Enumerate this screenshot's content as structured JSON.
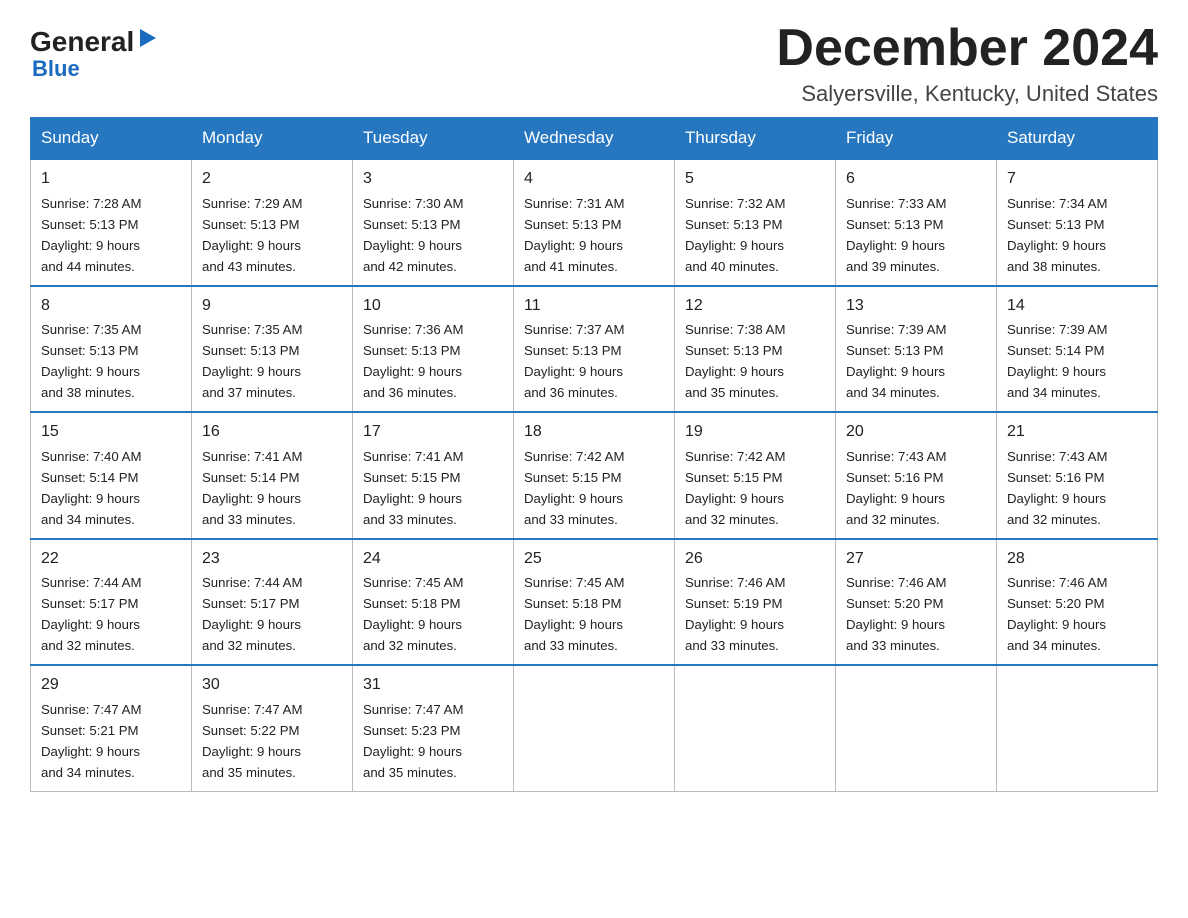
{
  "header": {
    "logo_main": "General",
    "logo_arrow": "▶",
    "logo_sub": "Blue",
    "month_title": "December 2024",
    "location": "Salyersville, Kentucky, United States"
  },
  "weekdays": [
    "Sunday",
    "Monday",
    "Tuesday",
    "Wednesday",
    "Thursday",
    "Friday",
    "Saturday"
  ],
  "weeks": [
    [
      {
        "day": "1",
        "sunrise": "Sunrise: 7:28 AM",
        "sunset": "Sunset: 5:13 PM",
        "daylight": "Daylight: 9 hours",
        "daylight2": "and 44 minutes."
      },
      {
        "day": "2",
        "sunrise": "Sunrise: 7:29 AM",
        "sunset": "Sunset: 5:13 PM",
        "daylight": "Daylight: 9 hours",
        "daylight2": "and 43 minutes."
      },
      {
        "day": "3",
        "sunrise": "Sunrise: 7:30 AM",
        "sunset": "Sunset: 5:13 PM",
        "daylight": "Daylight: 9 hours",
        "daylight2": "and 42 minutes."
      },
      {
        "day": "4",
        "sunrise": "Sunrise: 7:31 AM",
        "sunset": "Sunset: 5:13 PM",
        "daylight": "Daylight: 9 hours",
        "daylight2": "and 41 minutes."
      },
      {
        "day": "5",
        "sunrise": "Sunrise: 7:32 AM",
        "sunset": "Sunset: 5:13 PM",
        "daylight": "Daylight: 9 hours",
        "daylight2": "and 40 minutes."
      },
      {
        "day": "6",
        "sunrise": "Sunrise: 7:33 AM",
        "sunset": "Sunset: 5:13 PM",
        "daylight": "Daylight: 9 hours",
        "daylight2": "and 39 minutes."
      },
      {
        "day": "7",
        "sunrise": "Sunrise: 7:34 AM",
        "sunset": "Sunset: 5:13 PM",
        "daylight": "Daylight: 9 hours",
        "daylight2": "and 38 minutes."
      }
    ],
    [
      {
        "day": "8",
        "sunrise": "Sunrise: 7:35 AM",
        "sunset": "Sunset: 5:13 PM",
        "daylight": "Daylight: 9 hours",
        "daylight2": "and 38 minutes."
      },
      {
        "day": "9",
        "sunrise": "Sunrise: 7:35 AM",
        "sunset": "Sunset: 5:13 PM",
        "daylight": "Daylight: 9 hours",
        "daylight2": "and 37 minutes."
      },
      {
        "day": "10",
        "sunrise": "Sunrise: 7:36 AM",
        "sunset": "Sunset: 5:13 PM",
        "daylight": "Daylight: 9 hours",
        "daylight2": "and 36 minutes."
      },
      {
        "day": "11",
        "sunrise": "Sunrise: 7:37 AM",
        "sunset": "Sunset: 5:13 PM",
        "daylight": "Daylight: 9 hours",
        "daylight2": "and 36 minutes."
      },
      {
        "day": "12",
        "sunrise": "Sunrise: 7:38 AM",
        "sunset": "Sunset: 5:13 PM",
        "daylight": "Daylight: 9 hours",
        "daylight2": "and 35 minutes."
      },
      {
        "day": "13",
        "sunrise": "Sunrise: 7:39 AM",
        "sunset": "Sunset: 5:13 PM",
        "daylight": "Daylight: 9 hours",
        "daylight2": "and 34 minutes."
      },
      {
        "day": "14",
        "sunrise": "Sunrise: 7:39 AM",
        "sunset": "Sunset: 5:14 PM",
        "daylight": "Daylight: 9 hours",
        "daylight2": "and 34 minutes."
      }
    ],
    [
      {
        "day": "15",
        "sunrise": "Sunrise: 7:40 AM",
        "sunset": "Sunset: 5:14 PM",
        "daylight": "Daylight: 9 hours",
        "daylight2": "and 34 minutes."
      },
      {
        "day": "16",
        "sunrise": "Sunrise: 7:41 AM",
        "sunset": "Sunset: 5:14 PM",
        "daylight": "Daylight: 9 hours",
        "daylight2": "and 33 minutes."
      },
      {
        "day": "17",
        "sunrise": "Sunrise: 7:41 AM",
        "sunset": "Sunset: 5:15 PM",
        "daylight": "Daylight: 9 hours",
        "daylight2": "and 33 minutes."
      },
      {
        "day": "18",
        "sunrise": "Sunrise: 7:42 AM",
        "sunset": "Sunset: 5:15 PM",
        "daylight": "Daylight: 9 hours",
        "daylight2": "and 33 minutes."
      },
      {
        "day": "19",
        "sunrise": "Sunrise: 7:42 AM",
        "sunset": "Sunset: 5:15 PM",
        "daylight": "Daylight: 9 hours",
        "daylight2": "and 32 minutes."
      },
      {
        "day": "20",
        "sunrise": "Sunrise: 7:43 AM",
        "sunset": "Sunset: 5:16 PM",
        "daylight": "Daylight: 9 hours",
        "daylight2": "and 32 minutes."
      },
      {
        "day": "21",
        "sunrise": "Sunrise: 7:43 AM",
        "sunset": "Sunset: 5:16 PM",
        "daylight": "Daylight: 9 hours",
        "daylight2": "and 32 minutes."
      }
    ],
    [
      {
        "day": "22",
        "sunrise": "Sunrise: 7:44 AM",
        "sunset": "Sunset: 5:17 PM",
        "daylight": "Daylight: 9 hours",
        "daylight2": "and 32 minutes."
      },
      {
        "day": "23",
        "sunrise": "Sunrise: 7:44 AM",
        "sunset": "Sunset: 5:17 PM",
        "daylight": "Daylight: 9 hours",
        "daylight2": "and 32 minutes."
      },
      {
        "day": "24",
        "sunrise": "Sunrise: 7:45 AM",
        "sunset": "Sunset: 5:18 PM",
        "daylight": "Daylight: 9 hours",
        "daylight2": "and 32 minutes."
      },
      {
        "day": "25",
        "sunrise": "Sunrise: 7:45 AM",
        "sunset": "Sunset: 5:18 PM",
        "daylight": "Daylight: 9 hours",
        "daylight2": "and 33 minutes."
      },
      {
        "day": "26",
        "sunrise": "Sunrise: 7:46 AM",
        "sunset": "Sunset: 5:19 PM",
        "daylight": "Daylight: 9 hours",
        "daylight2": "and 33 minutes."
      },
      {
        "day": "27",
        "sunrise": "Sunrise: 7:46 AM",
        "sunset": "Sunset: 5:20 PM",
        "daylight": "Daylight: 9 hours",
        "daylight2": "and 33 minutes."
      },
      {
        "day": "28",
        "sunrise": "Sunrise: 7:46 AM",
        "sunset": "Sunset: 5:20 PM",
        "daylight": "Daylight: 9 hours",
        "daylight2": "and 34 minutes."
      }
    ],
    [
      {
        "day": "29",
        "sunrise": "Sunrise: 7:47 AM",
        "sunset": "Sunset: 5:21 PM",
        "daylight": "Daylight: 9 hours",
        "daylight2": "and 34 minutes."
      },
      {
        "day": "30",
        "sunrise": "Sunrise: 7:47 AM",
        "sunset": "Sunset: 5:22 PM",
        "daylight": "Daylight: 9 hours",
        "daylight2": "and 35 minutes."
      },
      {
        "day": "31",
        "sunrise": "Sunrise: 7:47 AM",
        "sunset": "Sunset: 5:23 PM",
        "daylight": "Daylight: 9 hours",
        "daylight2": "and 35 minutes."
      },
      null,
      null,
      null,
      null
    ]
  ]
}
